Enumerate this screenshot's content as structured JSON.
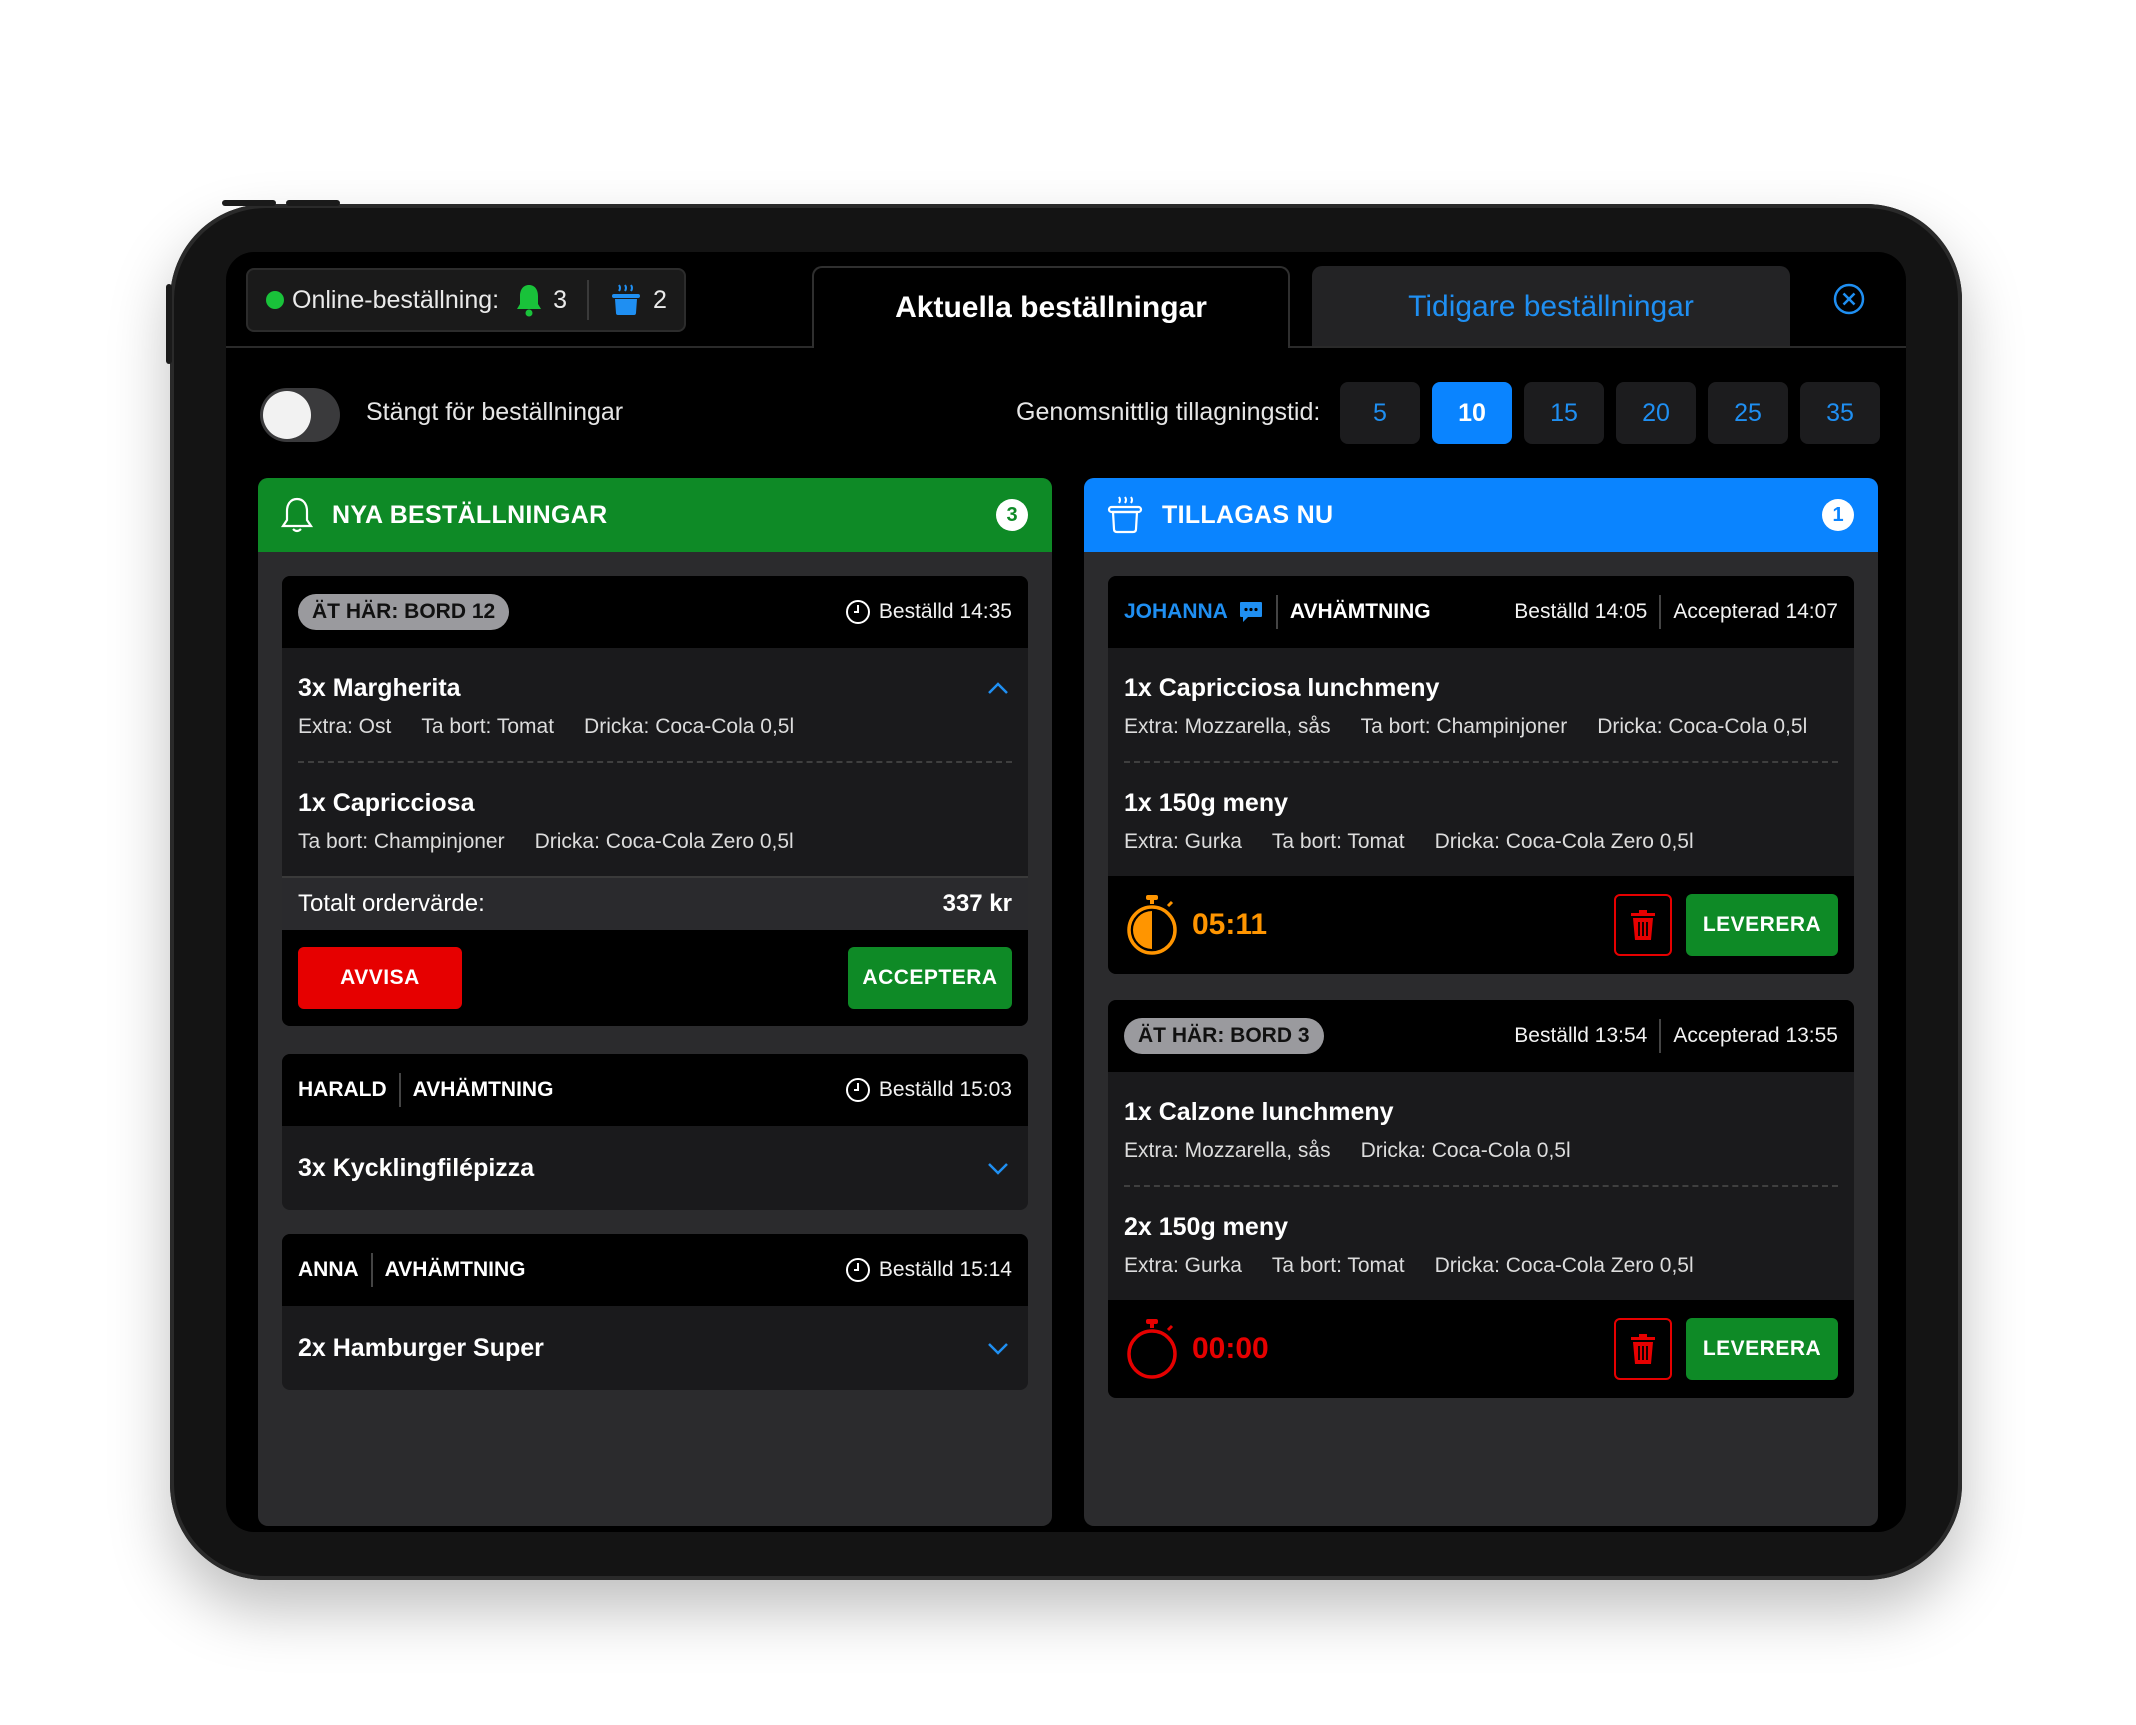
{
  "status": {
    "online_label": "Online-beställning:",
    "bell_count": "3",
    "pot_count": "2",
    "dot_color": "#19c23a"
  },
  "tabs": {
    "active": "Aktuella beställningar",
    "inactive": "Tidigare beställningar"
  },
  "toggle": {
    "label": "Stängt för beställningar",
    "on": false
  },
  "prep": {
    "label": "Genomsnittlig tillagningstid:",
    "options": [
      "5",
      "10",
      "15",
      "20",
      "25",
      "35"
    ],
    "selected": "10"
  },
  "new_orders": {
    "title": "NYA BESTÄLLNINGAR",
    "count": "3",
    "color": "#0e8a26",
    "cards": [
      {
        "badge": "ÄT HÄR: BORD 12",
        "ordered": "Beställd 14:35",
        "items": [
          {
            "name": "3x Margherita",
            "d1": "Extra: Ost",
            "d2": "Ta bort: Tomat",
            "d3": "Dricka: Coca-Cola 0,5l"
          },
          {
            "name": "1x Capricciosa",
            "d1": "Ta bort: Champinjoner",
            "d2": "Dricka: Coca-Cola Zero 0,5l"
          }
        ],
        "total_label": "Totalt ordervärde:",
        "total_value": "337 kr",
        "reject": "AVVISA",
        "accept": "ACCEPTERA"
      },
      {
        "name": "HARALD",
        "type": "AVHÄMTNING",
        "ordered": "Beställd 15:03",
        "item": "3x Kycklingfilépizza"
      },
      {
        "name": "ANNA",
        "type": "AVHÄMTNING",
        "ordered": "Beställd 15:14",
        "item": "2x Hamburger Super"
      }
    ]
  },
  "cooking": {
    "title": "TILLAGAS NU",
    "count": "1",
    "color": "#0a84ff",
    "cards": [
      {
        "name": "JOHANNA",
        "type": "AVHÄMTNING",
        "ordered": "Beställd 14:05",
        "accepted": "Accepterad 14:07",
        "items": [
          {
            "name": "1x Capricciosa lunchmeny",
            "d1": "Extra: Mozzarella, sås",
            "d2": "Ta bort: Champinjoner",
            "d3": "Dricka: Coca-Cola 0,5l"
          },
          {
            "name": "1x 150g meny",
            "d1": "Extra: Gurka",
            "d2": "Ta bort: Tomat",
            "d3": "Dricka: Coca-Cola Zero 0,5l"
          }
        ],
        "timer": "05:11",
        "timer_color": "#ff9500",
        "deliver": "LEVERERA"
      },
      {
        "badge": "ÄT HÄR: BORD 3",
        "ordered": "Beställd 13:54",
        "accepted": "Accepterad 13:55",
        "items": [
          {
            "name": "1x Calzone lunchmeny",
            "d1": "Extra: Mozzarella, sås",
            "d2": "Dricka: Coca-Cola 0,5l"
          },
          {
            "name": "2x 150g meny",
            "d1": "Extra: Gurka",
            "d2": "Ta bort: Tomat",
            "d3": "Dricka: Coca-Cola Zero 0,5l"
          }
        ],
        "timer": "00:00",
        "timer_color": "#e60000",
        "deliver": "LEVERERA"
      }
    ]
  }
}
